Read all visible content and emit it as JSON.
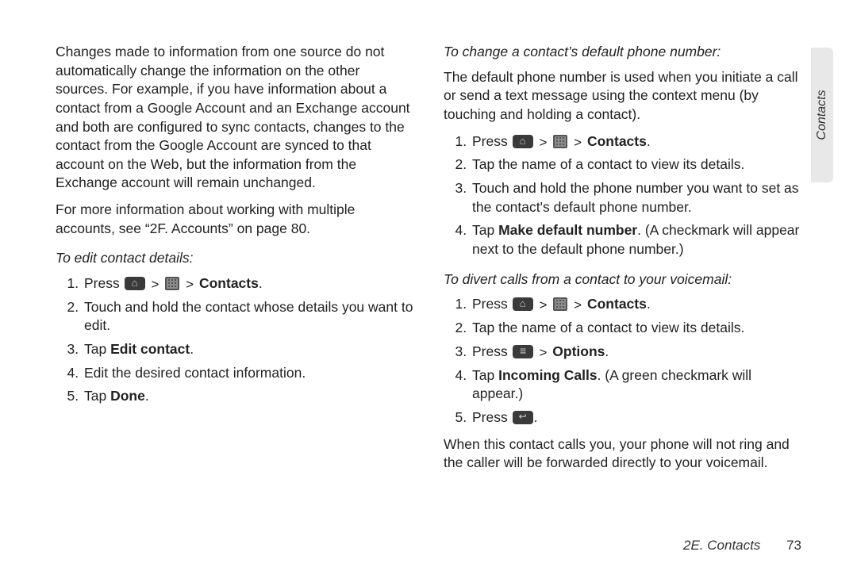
{
  "left": {
    "p1": "Changes made to information from one source do not automatically change the information on the other sources. For example, if you have information about a contact from a Google Account and an Exchange account and both are configured to sync contacts, changes to the contact from the Google Account are synced to that account on the Web, but the information from the Exchange account will remain unchanged.",
    "p2": "For more information about working with multiple accounts, see “2F. Accounts” on page 80.",
    "h1": "To edit contact details:",
    "s1_press": "Press ",
    "s1_contacts": "Contacts",
    "s2": "Touch and hold the contact whose details you want to edit.",
    "s3_a": "Tap ",
    "s3_b": "Edit contact",
    "s4": "Edit the desired contact information.",
    "s5_a": "Tap ",
    "s5_b": "Done"
  },
  "right": {
    "h1": "To change a contact’s default phone number:",
    "p1": "The default phone number is used when you initiate a call or send a text message using the context menu (by touching and holding a contact).",
    "a1_press": "Press ",
    "a1_contacts": "Contacts",
    "a2": "Tap the name of a contact to view its details.",
    "a3": "Touch and hold the phone number you want to set as the contact's default phone number.",
    "a4_a": "Tap ",
    "a4_b": "Make default number",
    "a4_c": ". (A checkmark will appear next to the default phone number.)",
    "h2": "To divert calls from a contact to your voicemail:",
    "b1_press": "Press ",
    "b1_contacts": "Contacts",
    "b2": "Tap the name of a contact to view its details.",
    "b3_a": "Press ",
    "b3_b": "Options",
    "b4_a": "Tap ",
    "b4_b": "Incoming Calls",
    "b4_c": ". (A green checkmark will appear.)",
    "b5": "Press ",
    "p2": "When this contact calls you, your phone will not ring and the caller will be forwarded directly to your voicemail."
  },
  "side_tab": "Contacts",
  "footer_section": "2E. Contacts",
  "footer_page": "73",
  "gt": ">"
}
